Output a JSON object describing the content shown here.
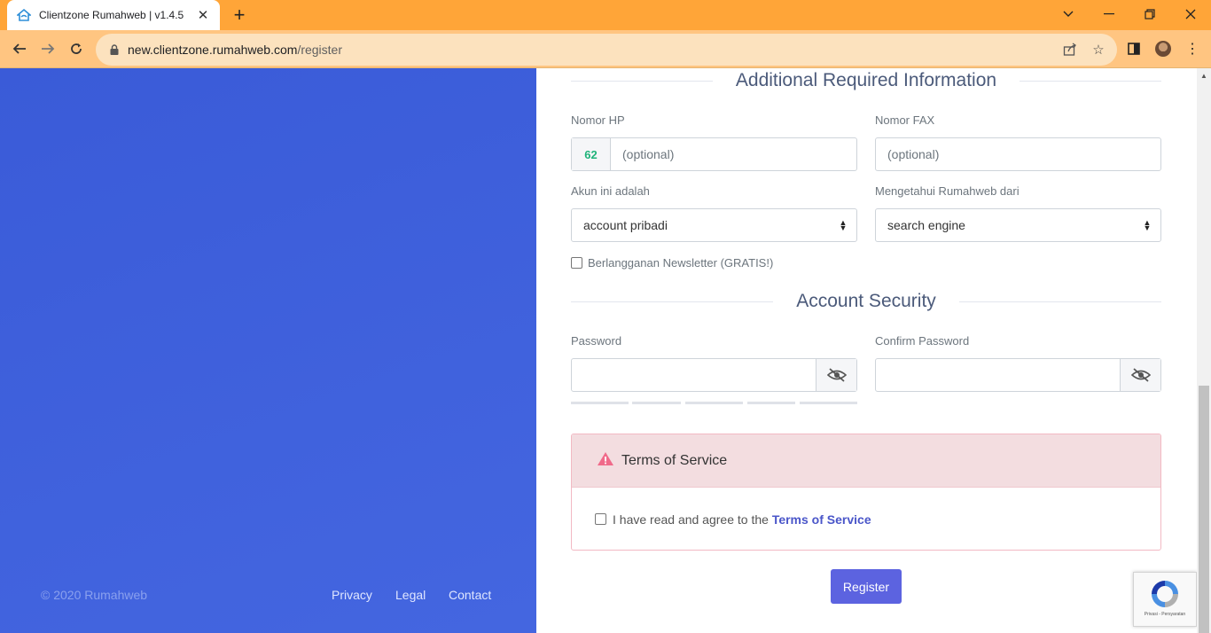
{
  "browser": {
    "tab_title": "Clientzone Rumahweb | v1.4.5",
    "url_host": "new.clientzone.rumahweb.com",
    "url_path": "/register"
  },
  "sections": {
    "additional": "Additional Required Information",
    "security": "Account Security"
  },
  "form": {
    "phone_label": "Nomor HP",
    "phone_prefix": "62",
    "phone_placeholder": "(optional)",
    "fax_label": "Nomor FAX",
    "fax_placeholder": "(optional)",
    "account_label": "Akun ini adalah",
    "account_value": "account pribadi",
    "source_label": "Mengetahui Rumahweb dari",
    "source_value": "search engine",
    "newsletter_label": "Berlangganan Newsletter (GRATIS!)",
    "password_label": "Password",
    "confirm_label": "Confirm Password"
  },
  "tos": {
    "title": "Terms of Service",
    "agree_text": "I have read and agree to the ",
    "agree_link": "Terms of Service"
  },
  "register_label": "Register",
  "recaptcha_text": "Privasi - Persyaratan",
  "footer": {
    "copyright": "© 2020 Rumahweb",
    "privacy": "Privacy",
    "legal": "Legal",
    "contact": "Contact"
  },
  "colors": {
    "tab_strip": "#ffa538",
    "left_panel": "#3a5bd8",
    "primary_button": "#5c63e0",
    "tos_header": "#f3dde0",
    "prefix_green": "#1fb37a"
  }
}
